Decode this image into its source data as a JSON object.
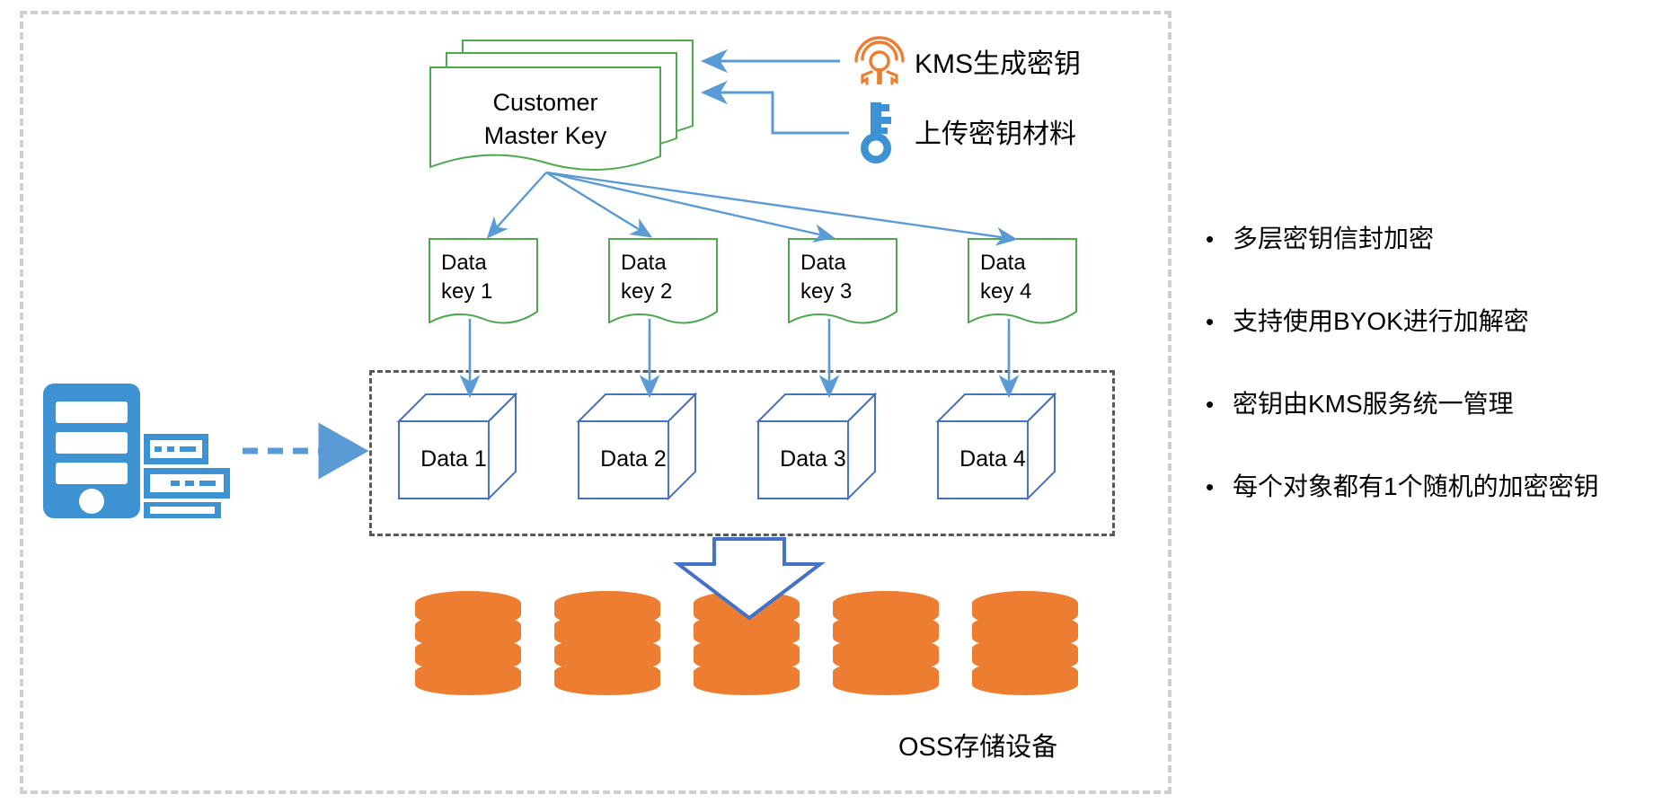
{
  "diagram": {
    "title_region": "OSS KMS envelope encryption architecture",
    "colors": {
      "doc_green": "#4EA84E",
      "arrow_blue": "#5B9BD5",
      "cube_blue": "#4472C4",
      "orange": "#ED7D31",
      "server_blue": "#3C92D2",
      "outer_dash": "#CFCFCF",
      "inner_dash": "#595959"
    },
    "cmk": {
      "line1": "Customer",
      "line2": "Master Key",
      "stack_count": 3
    },
    "data_keys": [
      {
        "line1": "Data",
        "line2": "key 1"
      },
      {
        "line1": "Data",
        "line2": "key 2"
      },
      {
        "line1": "Data",
        "line2": "key 3"
      },
      {
        "line1": "Data",
        "line2": "key 4"
      }
    ],
    "data_cubes": [
      {
        "label": "Data 1"
      },
      {
        "label": "Data 2"
      },
      {
        "label": "Data 3"
      },
      {
        "label": "Data 4"
      }
    ],
    "storage": {
      "label": "OSS存储设备",
      "cylinder_count": 5,
      "segments_per_cylinder": 4
    },
    "legend": [
      {
        "icon": "kms-medallion-icon",
        "label": "KMS生成密钥"
      },
      {
        "icon": "key-icon",
        "label": "上传密钥材料"
      }
    ],
    "bullets": [
      {
        "marker": "•",
        "text": "多层密钥信封加密"
      },
      {
        "marker": "•",
        "text": "支持使用BYOK进行加解密"
      },
      {
        "marker": "•",
        "text": "密钥由KMS服务统一管理"
      },
      {
        "marker": "•",
        "text": "每个对象都有1个随机的加密密钥"
      }
    ]
  }
}
